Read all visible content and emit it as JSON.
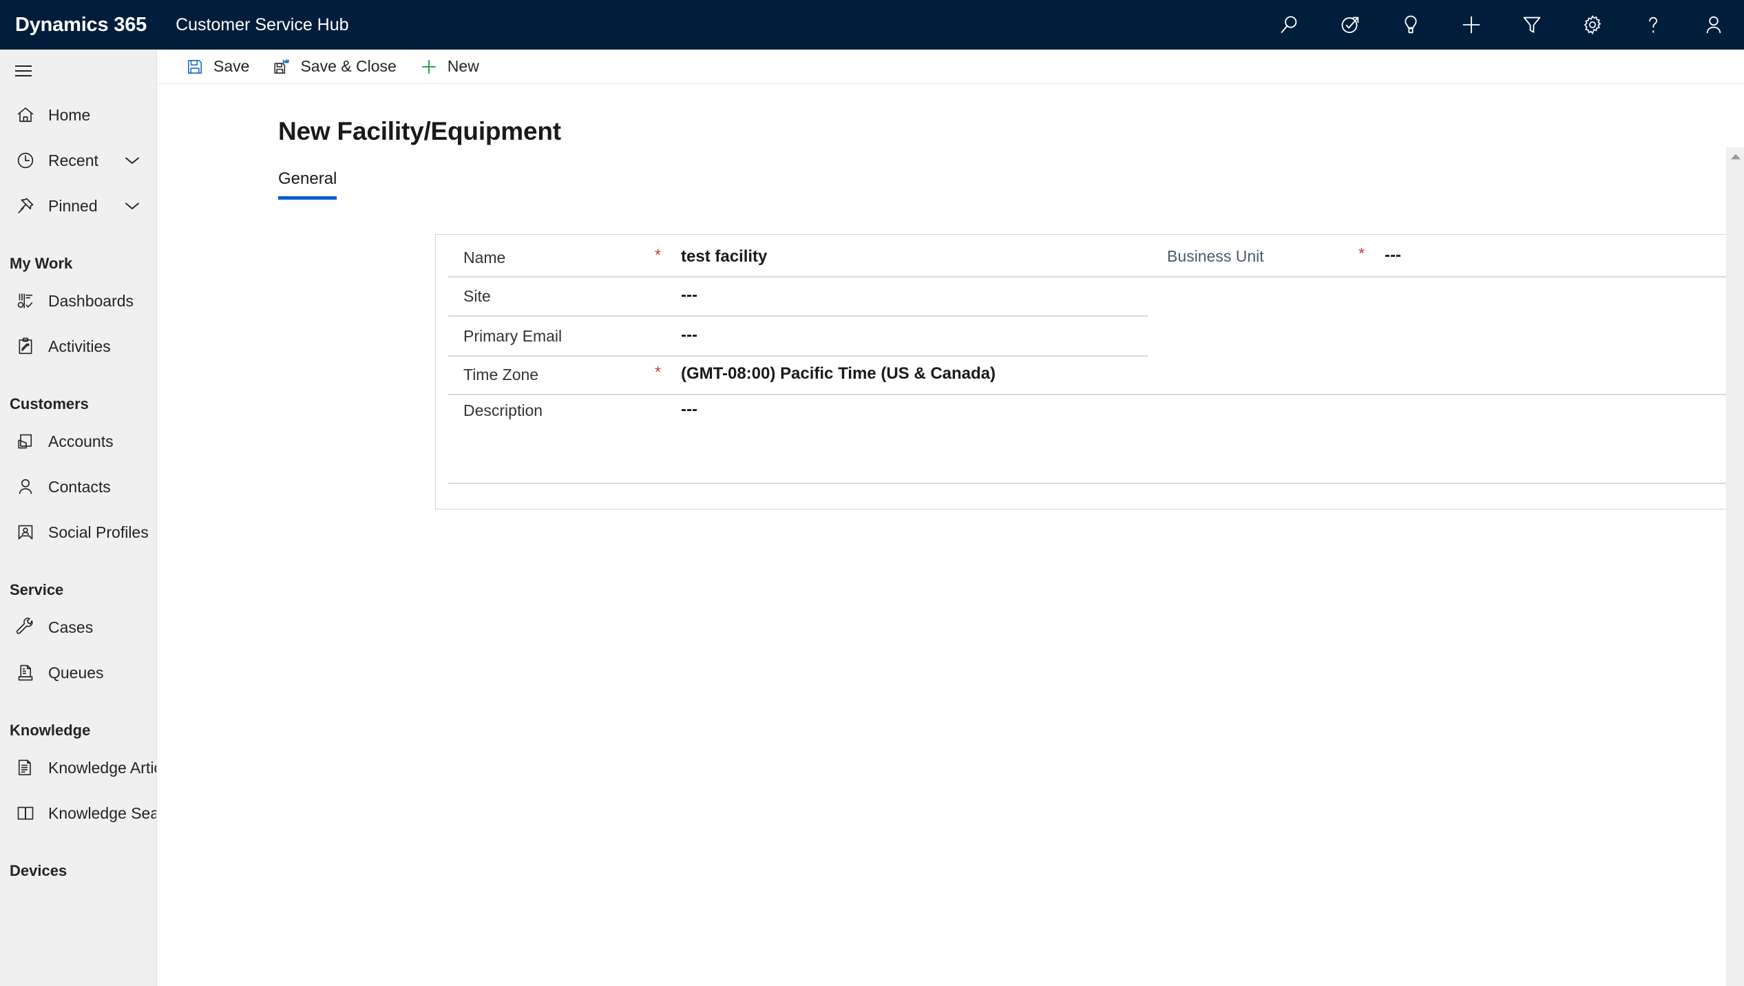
{
  "header": {
    "brand": "Dynamics 365",
    "app_name": "Customer Service Hub",
    "icons": [
      {
        "name": "search-icon",
        "label": "Search"
      },
      {
        "name": "assistant-icon",
        "label": "Assistant"
      },
      {
        "name": "lightbulb-icon",
        "label": "Insights"
      },
      {
        "name": "plus-icon",
        "label": "Quick create"
      },
      {
        "name": "filter-icon",
        "label": "Filter"
      },
      {
        "name": "gear-icon",
        "label": "Settings"
      },
      {
        "name": "question-icon",
        "label": "Help"
      },
      {
        "name": "person-icon",
        "label": "Account manager"
      }
    ]
  },
  "sidebar": {
    "hamburger_label": "Site Map",
    "primary": [
      {
        "label": "Home",
        "icon": "home-icon",
        "chevron": false
      },
      {
        "label": "Recent",
        "icon": "clock-icon",
        "chevron": true
      },
      {
        "label": "Pinned",
        "icon": "pin-icon",
        "chevron": true
      }
    ],
    "groups": [
      {
        "title": "My Work",
        "items": [
          {
            "label": "Dashboards",
            "icon": "dashboard-icon"
          },
          {
            "label": "Activities",
            "icon": "clipboard-icon"
          }
        ]
      },
      {
        "title": "Customers",
        "items": [
          {
            "label": "Accounts",
            "icon": "accounts-icon"
          },
          {
            "label": "Contacts",
            "icon": "contact-icon"
          },
          {
            "label": "Social Profiles",
            "icon": "social-profile-icon"
          }
        ]
      },
      {
        "title": "Service",
        "items": [
          {
            "label": "Cases",
            "icon": "wrench-icon"
          },
          {
            "label": "Queues",
            "icon": "queue-icon"
          }
        ]
      },
      {
        "title": "Knowledge",
        "items": [
          {
            "label": "Knowledge Articles",
            "icon": "article-icon"
          },
          {
            "label": "Knowledge Search",
            "icon": "book-icon"
          }
        ]
      },
      {
        "title": "Devices",
        "items": []
      }
    ]
  },
  "commandbar": {
    "buttons": [
      {
        "label": "Save",
        "icon": "save-icon"
      },
      {
        "label": "Save & Close",
        "icon": "save-close-icon"
      },
      {
        "label": "New",
        "icon": "new-plus-icon"
      }
    ]
  },
  "main": {
    "title": "New Facility/Equipment",
    "tabs": [
      {
        "label": "General",
        "active": true
      }
    ],
    "accent_color": "#0b5cd5",
    "required_color": "#d13438",
    "fields": [
      {
        "label": "Name",
        "required": true,
        "value": "test facility",
        "column": "left"
      },
      {
        "label": "Business Unit",
        "required": true,
        "value": "---",
        "column": "right"
      },
      {
        "label": "Site",
        "required": false,
        "value": "---",
        "column": "left"
      },
      {
        "label": "Primary Email",
        "required": false,
        "value": "---",
        "column": "left"
      },
      {
        "label": "Time Zone",
        "required": true,
        "value": "(GMT-08:00) Pacific Time (US & Canada)",
        "column": "left"
      },
      {
        "label": "Description",
        "required": false,
        "value": "---",
        "column": "left"
      }
    ]
  },
  "scrollbar": {
    "up_arrow": "scroll-up-arrow"
  }
}
